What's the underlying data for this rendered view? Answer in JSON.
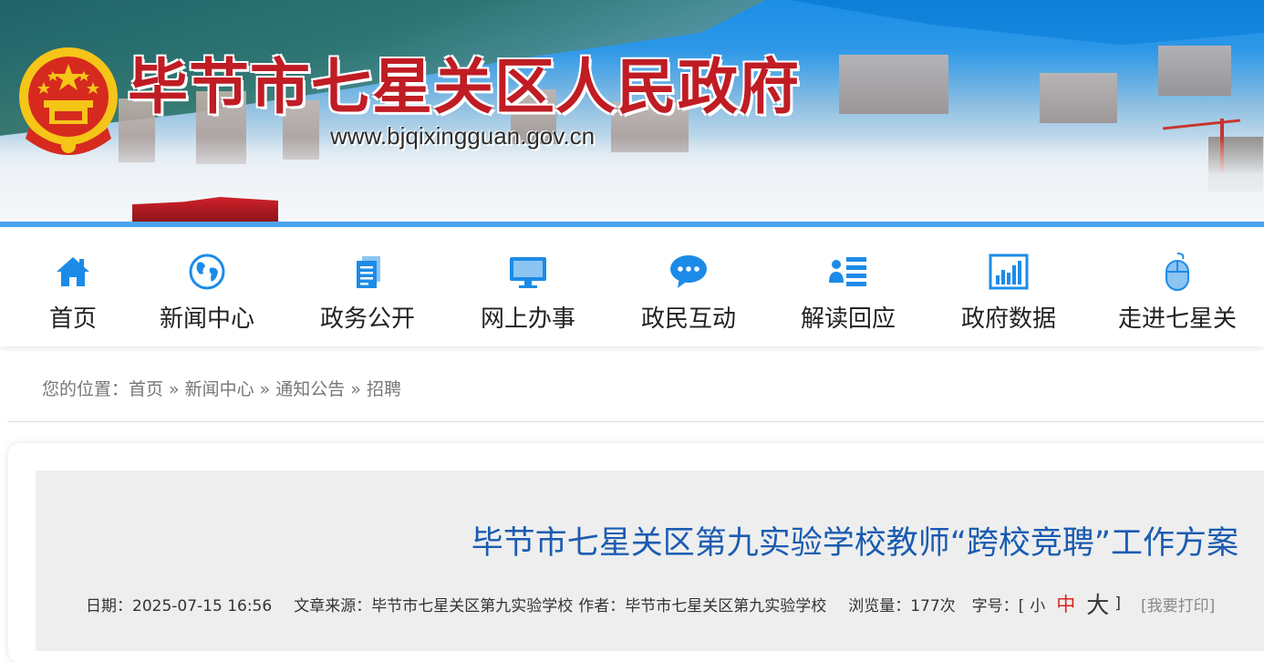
{
  "header": {
    "site_title": "毕节市七星关区人民政府",
    "site_url": "www.bjqixingguan.gov.cn"
  },
  "nav": {
    "items": [
      {
        "label": "首页",
        "icon": "home-icon"
      },
      {
        "label": "新闻中心",
        "icon": "globe-icon"
      },
      {
        "label": "政务公开",
        "icon": "document-icon"
      },
      {
        "label": "网上办事",
        "icon": "monitor-icon"
      },
      {
        "label": "政民互动",
        "icon": "chat-bubble-icon"
      },
      {
        "label": "解读回应",
        "icon": "person-list-icon"
      },
      {
        "label": "政府数据",
        "icon": "bar-chart-icon"
      },
      {
        "label": "走进七星关",
        "icon": "mouse-icon"
      }
    ]
  },
  "breadcrumb": {
    "prefix": "您的位置：",
    "items": [
      "首页",
      "新闻中心",
      "通知公告",
      "招聘"
    ],
    "separator": "»"
  },
  "article": {
    "title": "毕节市七星关区第九实验学校教师“跨校竞聘”工作方案",
    "date": "日期：2025-07-15 16:56",
    "source": "文章来源：毕节市七星关区第九实验学校",
    "author": "作者：毕节市七星关区第九实验学校",
    "views": "浏览量：177次",
    "font_size_label": "字号：[",
    "font_small": "小",
    "font_medium": "中",
    "font_large": "大",
    "font_size_close": "]",
    "print": "[我要打印]"
  },
  "colors": {
    "title_red": "#c01c24",
    "nav_icon_blue": "#1c8be8",
    "article_title_blue": "#1b5cb1",
    "font_medium_red": "#d7261e"
  }
}
